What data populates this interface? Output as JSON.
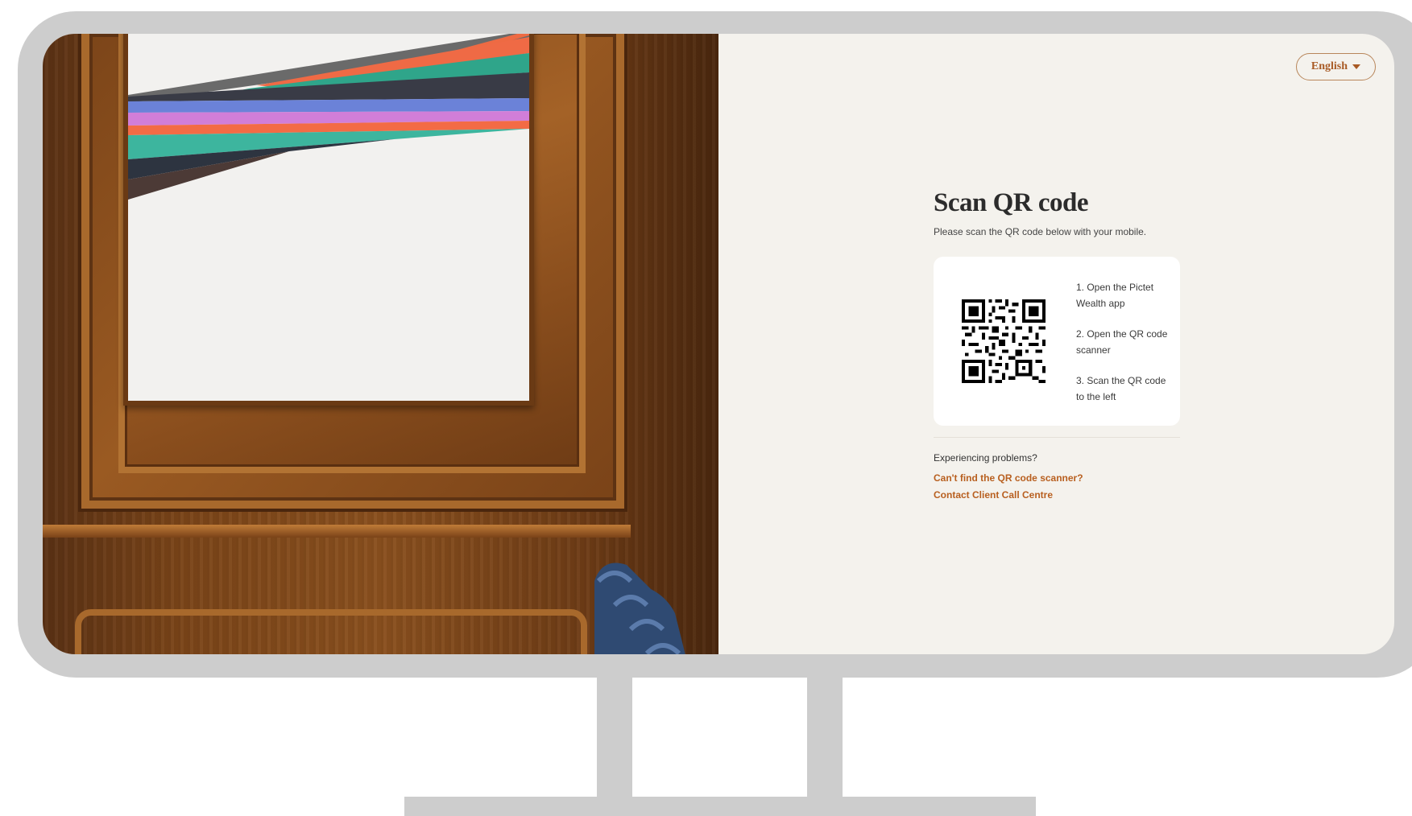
{
  "language_selector": {
    "label": "English",
    "icon": "caret-down-icon"
  },
  "main": {
    "title": "Scan QR code",
    "subtitle": "Please scan the QR code below with your mobile.",
    "steps": [
      "1. Open the Pictet Wealth app",
      "2. Open the QR code scanner",
      "3. Scan the QR code to the left"
    ]
  },
  "help": {
    "heading": "Experiencing problems?",
    "links": [
      "Can't find the QR code scanner?",
      "Contact Client Call Centre"
    ]
  },
  "colors": {
    "accent": "#b85f1f",
    "background": "#f4f2ed",
    "frame": "#cdcdcd"
  }
}
